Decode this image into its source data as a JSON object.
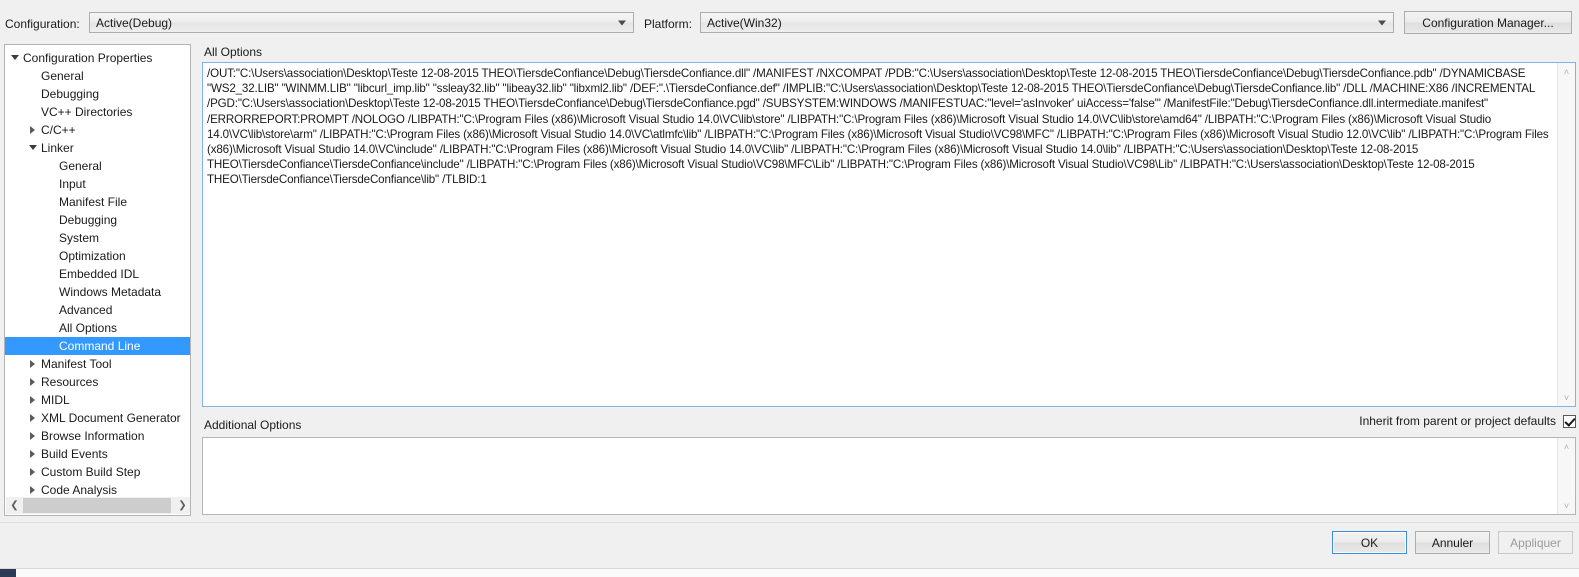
{
  "header": {
    "configuration_label": "Configuration:",
    "configuration_value": "Active(Debug)",
    "platform_label": "Platform:",
    "platform_value": "Active(Win32)",
    "configuration_manager_button": "Configuration Manager..."
  },
  "tree": {
    "root": "Configuration Properties",
    "items": [
      {
        "label": "Configuration Properties",
        "indent": 0,
        "twisty": "expanded",
        "selected": false
      },
      {
        "label": "General",
        "indent": 1,
        "twisty": "none",
        "selected": false
      },
      {
        "label": "Debugging",
        "indent": 1,
        "twisty": "none",
        "selected": false
      },
      {
        "label": "VC++ Directories",
        "indent": 1,
        "twisty": "none",
        "selected": false
      },
      {
        "label": "C/C++",
        "indent": 1,
        "twisty": "collapsed",
        "selected": false
      },
      {
        "label": "Linker",
        "indent": 1,
        "twisty": "expanded",
        "selected": false
      },
      {
        "label": "General",
        "indent": 2,
        "twisty": "none",
        "selected": false
      },
      {
        "label": "Input",
        "indent": 2,
        "twisty": "none",
        "selected": false
      },
      {
        "label": "Manifest File",
        "indent": 2,
        "twisty": "none",
        "selected": false
      },
      {
        "label": "Debugging",
        "indent": 2,
        "twisty": "none",
        "selected": false
      },
      {
        "label": "System",
        "indent": 2,
        "twisty": "none",
        "selected": false
      },
      {
        "label": "Optimization",
        "indent": 2,
        "twisty": "none",
        "selected": false
      },
      {
        "label": "Embedded IDL",
        "indent": 2,
        "twisty": "none",
        "selected": false
      },
      {
        "label": "Windows Metadata",
        "indent": 2,
        "twisty": "none",
        "selected": false
      },
      {
        "label": "Advanced",
        "indent": 2,
        "twisty": "none",
        "selected": false
      },
      {
        "label": "All Options",
        "indent": 2,
        "twisty": "none",
        "selected": false
      },
      {
        "label": "Command Line",
        "indent": 2,
        "twisty": "none",
        "selected": true
      },
      {
        "label": "Manifest Tool",
        "indent": 1,
        "twisty": "collapsed",
        "selected": false
      },
      {
        "label": "Resources",
        "indent": 1,
        "twisty": "collapsed",
        "selected": false
      },
      {
        "label": "MIDL",
        "indent": 1,
        "twisty": "collapsed",
        "selected": false
      },
      {
        "label": "XML Document Generator",
        "indent": 1,
        "twisty": "collapsed",
        "selected": false
      },
      {
        "label": "Browse Information",
        "indent": 1,
        "twisty": "collapsed",
        "selected": false
      },
      {
        "label": "Build Events",
        "indent": 1,
        "twisty": "collapsed",
        "selected": false
      },
      {
        "label": "Custom Build Step",
        "indent": 1,
        "twisty": "collapsed",
        "selected": false
      },
      {
        "label": "Code Analysis",
        "indent": 1,
        "twisty": "collapsed",
        "selected": false
      }
    ],
    "scroll_left_icon": "❮",
    "scroll_right_icon": "❯"
  },
  "main": {
    "all_options_label": "All Options",
    "all_options_value": "/OUT:\"C:\\Users\\association\\Desktop\\Teste 12-08-2015 THEO\\TiersdeConfiance\\Debug\\TiersdeConfiance.dll\" /MANIFEST /NXCOMPAT /PDB:\"C:\\Users\\association\\Desktop\\Teste 12-08-2015 THEO\\TiersdeConfiance\\Debug\\TiersdeConfiance.pdb\" /DYNAMICBASE \"WS2_32.LIB\" \"WINMM.LIB\" \"libcurl_imp.lib\" \"ssleay32.lib\" \"libeay32.lib\" \"libxml2.lib\" /DEF:\".\\TiersdeConfiance.def\" /IMPLIB:\"C:\\Users\\association\\Desktop\\Teste 12-08-2015 THEO\\TiersdeConfiance\\Debug\\TiersdeConfiance.lib\" /DLL /MACHINE:X86 /INCREMENTAL /PGD:\"C:\\Users\\association\\Desktop\\Teste 12-08-2015 THEO\\TiersdeConfiance\\Debug\\TiersdeConfiance.pgd\" /SUBSYSTEM:WINDOWS /MANIFESTUAC:\"level='asInvoker' uiAccess='false'\" /ManifestFile:\"Debug\\TiersdeConfiance.dll.intermediate.manifest\" /ERRORREPORT:PROMPT /NOLOGO /LIBPATH:\"C:\\Program Files (x86)\\Microsoft Visual Studio 14.0\\VC\\lib\\store\" /LIBPATH:\"C:\\Program Files (x86)\\Microsoft Visual Studio 14.0\\VC\\lib\\store\\amd64\" /LIBPATH:\"C:\\Program Files (x86)\\Microsoft Visual Studio 14.0\\VC\\lib\\store\\arm\" /LIBPATH:\"C:\\Program Files (x86)\\Microsoft Visual Studio 14.0\\VC\\atlmfc\\lib\" /LIBPATH:\"C:\\Program Files (x86)\\Microsoft Visual Studio\\VC98\\MFC\" /LIBPATH:\"C:\\Program Files (x86)\\Microsoft Visual Studio 12.0\\VC\\lib\" /LIBPATH:\"C:\\Program Files (x86)\\Microsoft Visual Studio 14.0\\VC\\include\" /LIBPATH:\"C:\\Program Files (x86)\\Microsoft Visual Studio 14.0\\VC\\lib\" /LIBPATH:\"C:\\Program Files (x86)\\Microsoft Visual Studio 14.0\\lib\" /LIBPATH:\"C:\\Users\\association\\Desktop\\Teste 12-08-2015 THEO\\TiersdeConfiance\\TiersdeConfiance\\include\" /LIBPATH:\"C:\\Program Files (x86)\\Microsoft Visual Studio\\VC98\\MFC\\Lib\" /LIBPATH:\"C:\\Program Files (x86)\\Microsoft Visual Studio\\VC98\\Lib\" /LIBPATH:\"C:\\Users\\association\\Desktop\\Teste 12-08-2015 THEO\\TiersdeConfiance\\TiersdeConfiance\\lib\" /TLBID:1",
    "additional_options_label": "Additional Options",
    "additional_options_value": "",
    "inherit_label": "Inherit from parent or project defaults",
    "inherit_checked": true,
    "scroll_up_icon": "˄",
    "scroll_down_icon": "˅"
  },
  "footer": {
    "ok_button": "OK",
    "cancel_button": "Annuler",
    "apply_button": "Appliquer"
  },
  "colors": {
    "selection": "#3399ff",
    "focus_border": "#7eb4ea",
    "window_bg": "#f0f0f0",
    "field_bg": "#ffffff"
  }
}
